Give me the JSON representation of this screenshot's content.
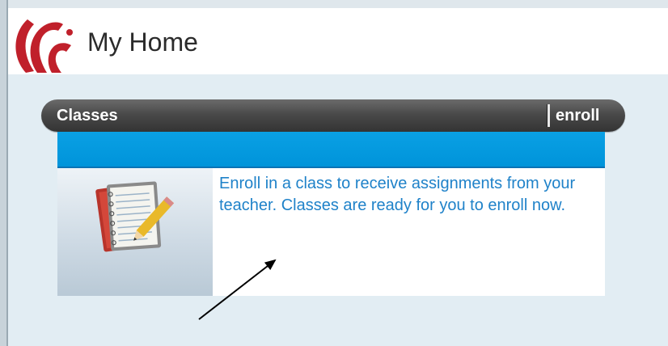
{
  "header": {
    "title": "My Home"
  },
  "classes_panel": {
    "bar_title": "Classes",
    "enroll_link": "enroll",
    "message": "Enroll in a class to receive assignments from your teacher. Classes are ready for you to enroll now."
  },
  "icons": {
    "logo": "red-swirl-logo-icon",
    "illustration": "notebook-pencil-icon",
    "annotation": "annotation-arrow"
  },
  "colors": {
    "bar": "#4a4a4a",
    "band": "#0a9be0",
    "link_text": "#1f82c9",
    "background": "#e2edf3",
    "logo_red": "#c0202b"
  }
}
